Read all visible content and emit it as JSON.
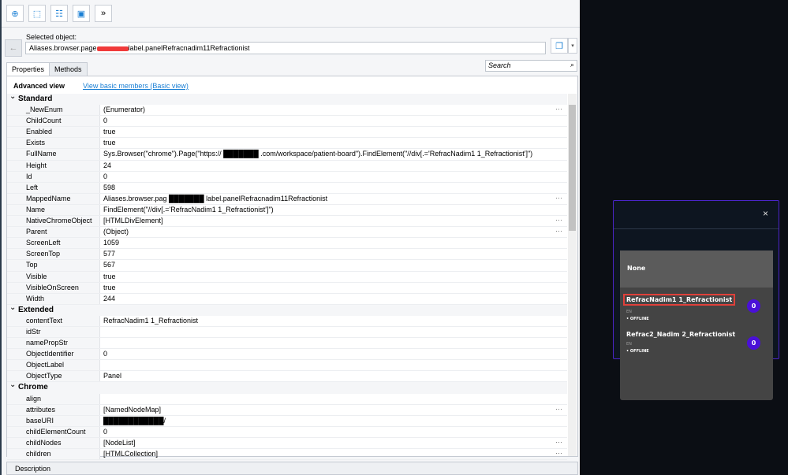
{
  "toolbar": {
    "more_label": "»"
  },
  "selected": {
    "label": "Selected object:",
    "value_prefix": "Aliases.browser.page",
    "value_suffix": "label.panelRefracnadim11Refractionist"
  },
  "search": {
    "placeholder": "Search"
  },
  "tabs": [
    "Properties",
    "Methods"
  ],
  "view": {
    "title": "Advanced view",
    "link": "View basic members (Basic view)"
  },
  "categories": [
    {
      "name": "Standard",
      "rows": [
        [
          "_NewEnum",
          "(Enumerator)",
          true
        ],
        [
          "ChildCount",
          "0"
        ],
        [
          "Enabled",
          "true"
        ],
        [
          "Exists",
          "true"
        ],
        [
          "FullName",
          "Sys.Browser(\"chrome\").Page(\"https:// ███████ .com/workspace/patient-board\").FindElement(\"//div[.='RefracNadim1 1_Refractionist']\")"
        ],
        [
          "Height",
          "24"
        ],
        [
          "Id",
          "0"
        ],
        [
          "Left",
          "598"
        ],
        [
          "MappedName",
          "Aliases.browser.pag ███████ label.panelRefracnadim11Refractionist",
          true
        ],
        [
          "Name",
          "FindElement(\"//div[.='RefracNadim1 1_Refractionist']\")"
        ],
        [
          "NativeChromeObject",
          "[HTMLDivElement]",
          true
        ],
        [
          "Parent",
          "(Object)",
          true
        ],
        [
          "ScreenLeft",
          "1059"
        ],
        [
          "ScreenTop",
          "577"
        ],
        [
          "Top",
          "567"
        ],
        [
          "Visible",
          "true"
        ],
        [
          "VisibleOnScreen",
          "true"
        ],
        [
          "Width",
          "244"
        ]
      ]
    },
    {
      "name": "Extended",
      "rows": [
        [
          "contentText",
          "RefracNadim1 1_Refractionist"
        ],
        [
          "idStr",
          ""
        ],
        [
          "namePropStr",
          ""
        ],
        [
          "ObjectIdentifier",
          "0"
        ],
        [
          "ObjectLabel",
          ""
        ],
        [
          "ObjectType",
          "Panel"
        ]
      ]
    },
    {
      "name": "Chrome",
      "rows": [
        [
          "align",
          ""
        ],
        [
          "attributes",
          "[NamedNodeMap]",
          true
        ],
        [
          "baseURI",
          "████████████/"
        ],
        [
          "childElementCount",
          "0"
        ],
        [
          "childNodes",
          "[NodeList]",
          true
        ],
        [
          "children",
          "[HTMLCollection]",
          true
        ]
      ]
    }
  ],
  "description": "Description",
  "modal": {
    "close": "×",
    "none": "None",
    "items": [
      {
        "name": "RefracNadim1 1_Refractionist",
        "lang": "EN",
        "status": "• OFFLINE",
        "count": "0"
      },
      {
        "name": "Refrac2_Nadim 2_Refractionist",
        "lang": "EN",
        "status": "• OFFLINE",
        "count": "0"
      }
    ]
  }
}
